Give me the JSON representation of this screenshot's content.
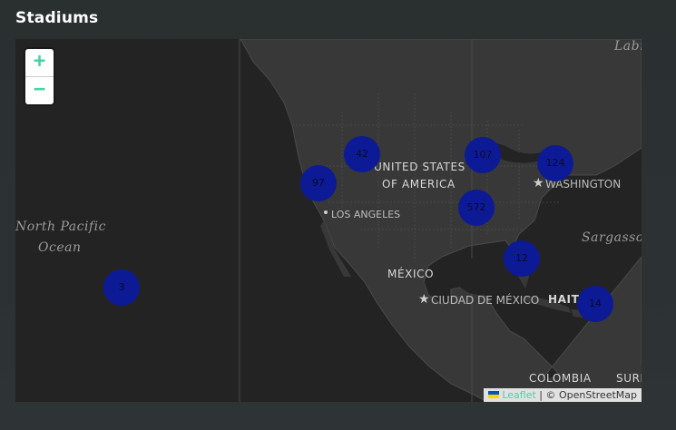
{
  "panel": {
    "title": "Stadiums"
  },
  "zoom": {
    "in_label": "+",
    "out_label": "−"
  },
  "labels": {
    "usa_line1": "UNITED STATES",
    "usa_line2": "OF AMERICA",
    "mexico": "MÉXICO",
    "colombia": "COLOMBIA",
    "haiti": "HAITI",
    "washington": "WASHINGTON",
    "los_angeles": "LOS ANGELES",
    "ciudad_mexico": "CIUDAD DE MÉXICO",
    "ocean_line1": "North Pacific",
    "ocean_line2": "Ocean",
    "sargasso": "Sargasso",
    "labrador": "Labr",
    "suriname": "SURI"
  },
  "clusters": [
    {
      "id": "hawaii",
      "count": "3"
    },
    {
      "id": "california",
      "count": "97"
    },
    {
      "id": "rockies",
      "count": "42"
    },
    {
      "id": "midwest",
      "count": "107"
    },
    {
      "id": "south",
      "count": "572"
    },
    {
      "id": "northeast",
      "count": "124"
    },
    {
      "id": "florida",
      "count": "12"
    },
    {
      "id": "caribbean",
      "count": "14"
    }
  ],
  "attribution": {
    "leaflet": "Leaflet",
    "separator": " | ",
    "osm": "© OpenStreetMap"
  },
  "colors": {
    "map_bg": "#232323",
    "cluster": "#0d1a95",
    "accent": "#46d3a6"
  }
}
